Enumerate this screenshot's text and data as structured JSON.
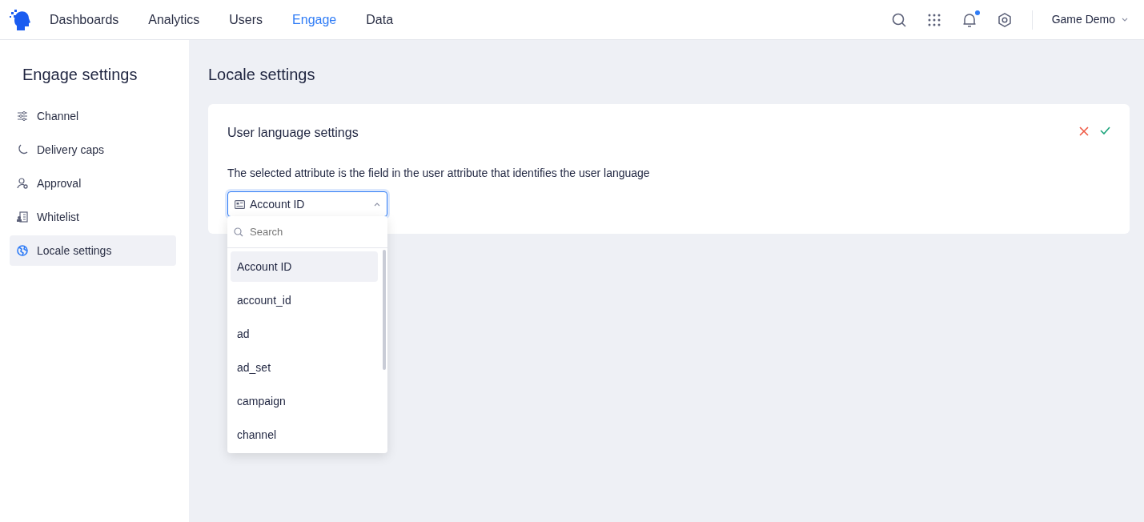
{
  "nav": {
    "items": [
      {
        "label": "Dashboards",
        "selected": false
      },
      {
        "label": "Analytics",
        "selected": false
      },
      {
        "label": "Users",
        "selected": false
      },
      {
        "label": "Engage",
        "selected": true
      },
      {
        "label": "Data",
        "selected": false
      }
    ],
    "notification_dot": true,
    "project": "Game Demo"
  },
  "sidebar": {
    "title": "Engage settings",
    "items": [
      {
        "label": "Channel",
        "selected": false
      },
      {
        "label": "Delivery caps",
        "selected": false
      },
      {
        "label": "Approval",
        "selected": false
      },
      {
        "label": "Whitelist",
        "selected": false
      },
      {
        "label": "Locale settings",
        "selected": true
      }
    ]
  },
  "page_title": "Locale settings",
  "card": {
    "title": "User language settings",
    "description": "The selected attribute is the field in the user attribute that identifies the user language",
    "select": {
      "value": "Account ID",
      "expanded": true,
      "search_placeholder": "Search",
      "options": [
        {
          "label": "Account ID",
          "selected": true
        },
        {
          "label": "account_id",
          "selected": false
        },
        {
          "label": "ad",
          "selected": false
        },
        {
          "label": "ad_set",
          "selected": false
        },
        {
          "label": "campaign",
          "selected": false
        },
        {
          "label": "channel",
          "selected": false
        }
      ]
    }
  }
}
